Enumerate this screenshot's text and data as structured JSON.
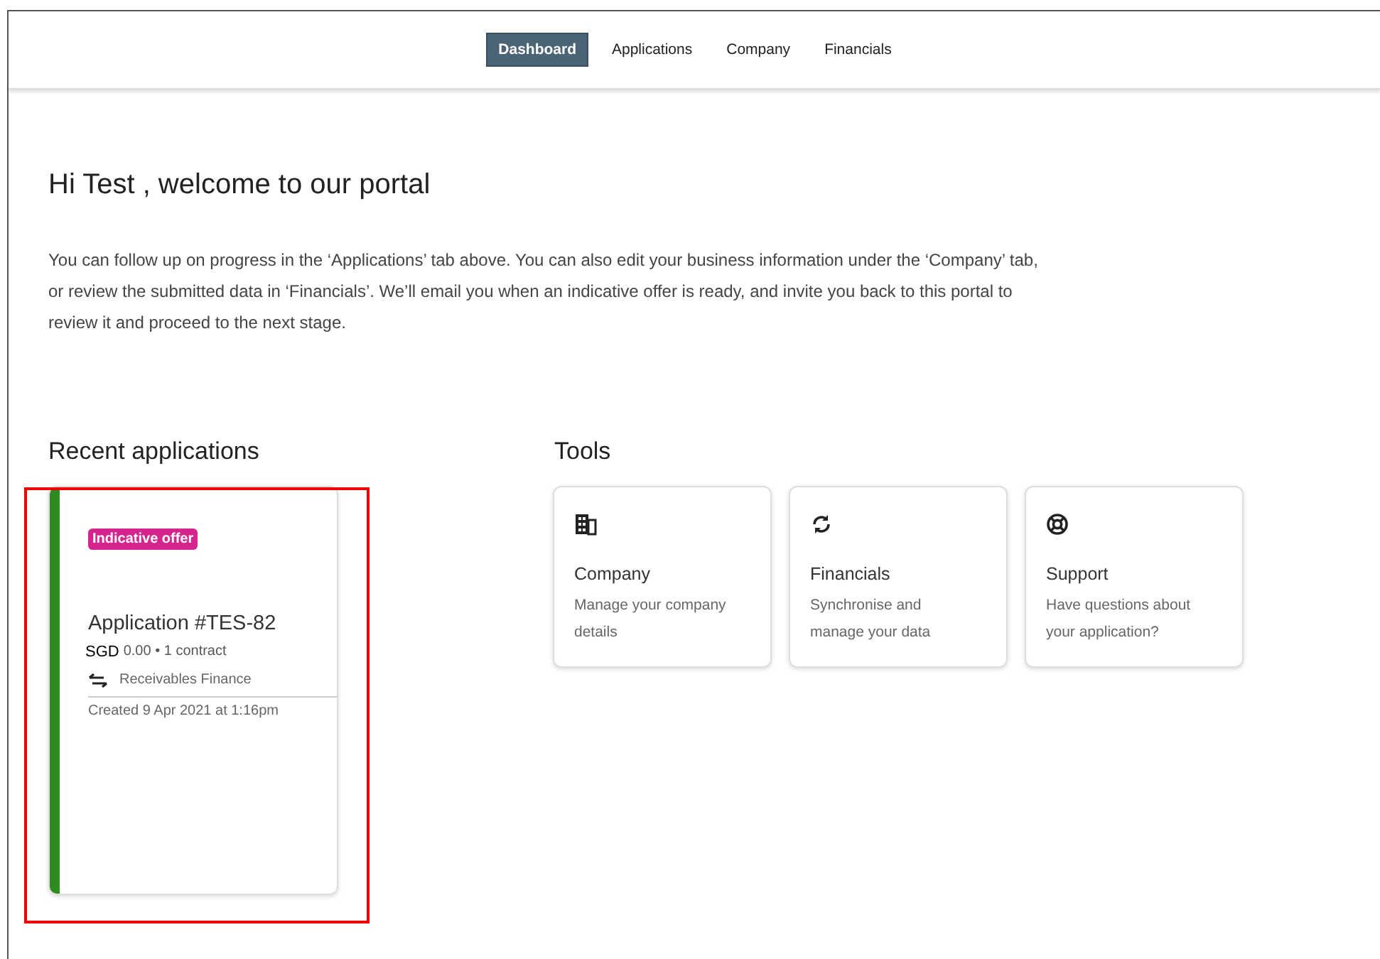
{
  "nav": {
    "tabs": [
      {
        "label": "Dashboard",
        "selected": true
      },
      {
        "label": "Applications",
        "selected": false
      },
      {
        "label": "Company",
        "selected": false
      },
      {
        "label": "Financials",
        "selected": false
      }
    ]
  },
  "greeting": "Hi Test , welcome to our portal",
  "intro_lines": [
    "You can follow up on progress in the ‘Applications’ tab above. You can also edit your business information under the ‘Company’ tab,",
    "or review the submitted data in ‘Financials’. We’ll email you when an indicative offer is ready, and invite you back to this portal to",
    "review it and proceed to the next stage."
  ],
  "recent": {
    "title": "Recent applications",
    "applications": [
      {
        "status": "Indicative offer",
        "highlighted": true,
        "title": "Application #TES-82",
        "currency": "SGD",
        "summary": "0.00 • 1 contract",
        "product": "Receivables Finance",
        "created": "Created 9 Apr 2021 at 1:16pm"
      }
    ]
  },
  "tools": {
    "title": "Tools",
    "items": [
      {
        "kind": "building",
        "title": "Company",
        "description": "Manage your company details"
      },
      {
        "kind": "sync",
        "title": "Financials",
        "description": "Synchronise and manage your data"
      },
      {
        "kind": "lifebuoy",
        "title": "Support",
        "description": "Have questions about your application?"
      }
    ]
  }
}
